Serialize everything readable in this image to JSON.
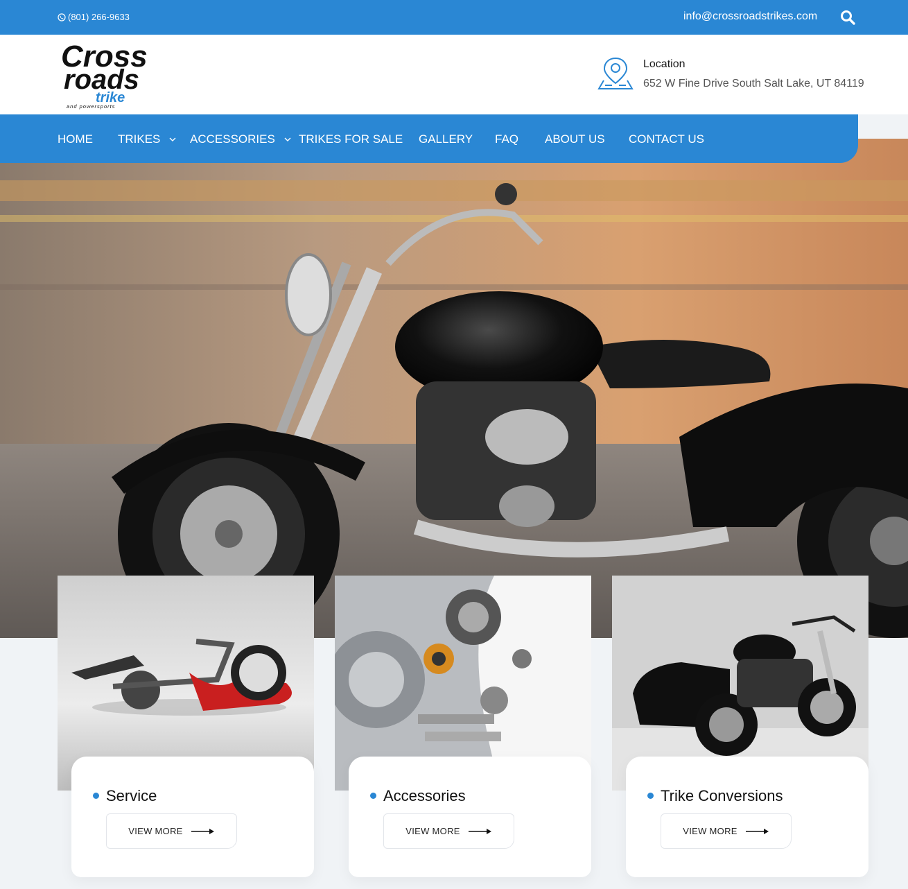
{
  "topbar": {
    "phone": "(801) 266-9633",
    "email": "info@crossroadstrikes.com",
    "search_icon": "search-icon"
  },
  "header": {
    "logo": {
      "line1": "Cross",
      "line2": "roads",
      "line3": "trike",
      "line4": "and powersports"
    },
    "location_label": "Location",
    "location_address": "652 W Fine Drive South Salt Lake, UT 84119"
  },
  "nav": {
    "items": [
      {
        "label": "HOME"
      },
      {
        "label": "TRIKES"
      },
      {
        "label": "ACCESSORIES"
      },
      {
        "label": "TRIKES FOR SALE"
      },
      {
        "label": "GALLERY"
      },
      {
        "label": "FAQ"
      },
      {
        "label": "ABOUT US"
      },
      {
        "label": "CONTACT US"
      }
    ]
  },
  "cards": [
    {
      "title": "Service",
      "button": "VIEW MORE"
    },
    {
      "title": "Accessories",
      "button": "VIEW MORE"
    },
    {
      "title": "Trike Conversions",
      "button": "VIEW MORE"
    }
  ],
  "colors": {
    "brand_blue": "#2a87d4",
    "page_bg": "#f0f3f6"
  }
}
